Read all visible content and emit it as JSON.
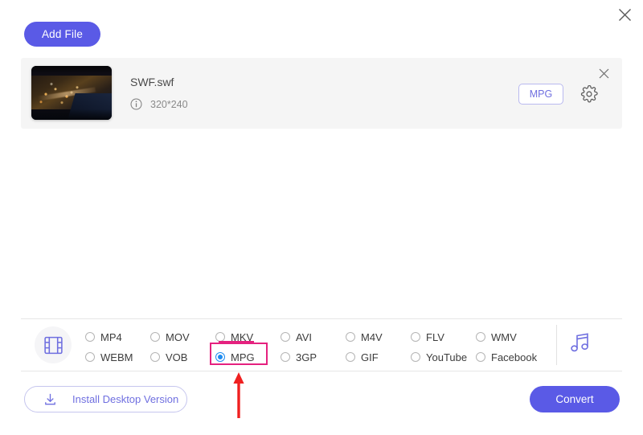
{
  "window": {
    "close_icon": "close-icon"
  },
  "toolbar": {
    "add_file_label": "Add File"
  },
  "file_row": {
    "name": "SWF.swf",
    "resolution": "320*240",
    "info_icon": "info-icon",
    "output_format_badge": "MPG",
    "settings_icon": "gear-icon",
    "remove_icon": "close-icon",
    "thumbnail_alt": "night-cityscape-thumbnail"
  },
  "format_bar": {
    "video_icon": "film-strip-icon",
    "audio_icon": "music-note-icon",
    "selected": "MPG",
    "options": [
      {
        "label": "MP4",
        "selected": false,
        "col": 0,
        "row": 0
      },
      {
        "label": "MOV",
        "selected": false,
        "col": 1,
        "row": 0
      },
      {
        "label": "MKV",
        "selected": false,
        "col": 2,
        "row": 0
      },
      {
        "label": "AVI",
        "selected": false,
        "col": 3,
        "row": 0
      },
      {
        "label": "M4V",
        "selected": false,
        "col": 4,
        "row": 0
      },
      {
        "label": "FLV",
        "selected": false,
        "col": 5,
        "row": 0
      },
      {
        "label": "WMV",
        "selected": false,
        "col": 6,
        "row": 0
      },
      {
        "label": "WEBM",
        "selected": false,
        "col": 0,
        "row": 1
      },
      {
        "label": "VOB",
        "selected": false,
        "col": 1,
        "row": 1
      },
      {
        "label": "MPG",
        "selected": true,
        "col": 2,
        "row": 1
      },
      {
        "label": "3GP",
        "selected": false,
        "col": 3,
        "row": 1
      },
      {
        "label": "GIF",
        "selected": false,
        "col": 4,
        "row": 1
      },
      {
        "label": "YouTube",
        "selected": false,
        "col": 5,
        "row": 1
      },
      {
        "label": "Facebook",
        "selected": false,
        "col": 6,
        "row": 1
      }
    ]
  },
  "footer": {
    "install_label": "Install Desktop Version",
    "install_icon": "download-icon",
    "convert_label": "Convert"
  },
  "annotations": {
    "highlight_color": "#e5217f",
    "arrow_color": "#ef2020",
    "arrow_target": "MPG"
  },
  "colors": {
    "accent": "#5a5ae6",
    "accent_light": "#6f6fe0",
    "radio_selected": "#1f8cf0",
    "panel_bg": "#f5f5f5",
    "highlight": "#e5217f"
  }
}
